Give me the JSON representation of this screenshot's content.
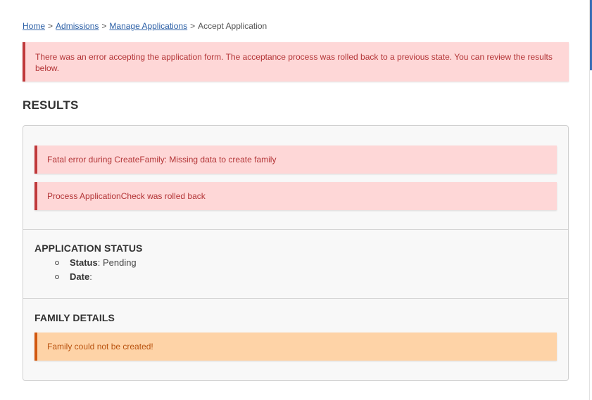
{
  "breadcrumb": {
    "items": [
      {
        "label": "Home",
        "link": true
      },
      {
        "label": "Admissions",
        "link": true
      },
      {
        "label": "Manage Applications",
        "link": true
      },
      {
        "label": "Accept Application",
        "link": false
      }
    ],
    "separator": ">"
  },
  "top_alert": {
    "message": "There was an error accepting the application form. The acceptance process was rolled back to a previous state. You can review the results below."
  },
  "results": {
    "title": "RESULTS",
    "messages": [
      "Fatal error during CreateFamily: Missing data to create family",
      "Process ApplicationCheck was rolled back"
    ],
    "application_status": {
      "title": "APPLICATION STATUS",
      "status_label": "Status",
      "status_value": ": Pending",
      "date_label": "Date",
      "date_value": ":"
    },
    "family_details": {
      "title": "FAMILY DETAILS",
      "warning": "Family could not be created!"
    }
  },
  "colors": {
    "error_bg": "#fed7d7",
    "error_border": "#c0393b",
    "warning_bg": "#fed3a7",
    "warning_border": "#d2580f",
    "link": "#2b5fa6"
  }
}
